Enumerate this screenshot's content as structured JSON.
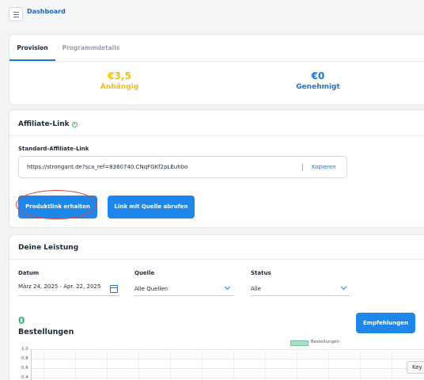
{
  "header": {
    "title": "Dashboard",
    "menu_icon": "hamburger-menu-icon"
  },
  "tabs": [
    {
      "label": "Provision",
      "active": true
    },
    {
      "label": "Programmdetails",
      "active": false
    }
  ],
  "stats": {
    "pending": {
      "value": "€3,5",
      "label": "Anhängig",
      "color": "#f2c00e"
    },
    "approved": {
      "value": "€0",
      "label": "Genehmigt",
      "color": "#1f73dc"
    }
  },
  "affiliate": {
    "title": "Affiliate-Link",
    "info_icon": "info-icon",
    "standard_label": "Standard-Affiliate-Link",
    "url": "https://strongant.de?sca_ref=8360740.CNqFGKf2pLEuhbo",
    "copy_label": "Kopieren",
    "product_link_button": "Produktlink erhalten",
    "source_link_button": "Link mit Quelle abrufen"
  },
  "performance": {
    "title": "Deine Leistung",
    "filters": {
      "date": {
        "label": "Datum",
        "value": "März 24, 2025 - Apr. 22, 2025",
        "icon": "calendar-icon"
      },
      "source": {
        "label": "Quelle",
        "value": "Alle Quellen"
      },
      "status": {
        "label": "Status",
        "value": "Alle"
      }
    },
    "orders_count": "0",
    "orders_label": "Bestellungen",
    "recommend_button": "Empfehlungen",
    "chart_data": {
      "type": "bar",
      "series": [
        {
          "name": "Bestellungen",
          "values": []
        }
      ],
      "yticks": [
        "1.0",
        "0.8",
        "0.6",
        "0.4"
      ],
      "legend": "top-center",
      "grid": true
    }
  },
  "key_button": "Key",
  "colors": {
    "accent": "#1f86ea",
    "brand_blue": "#1f73dc",
    "pending_yellow": "#f2c00e",
    "success_green": "#3fb27a"
  }
}
